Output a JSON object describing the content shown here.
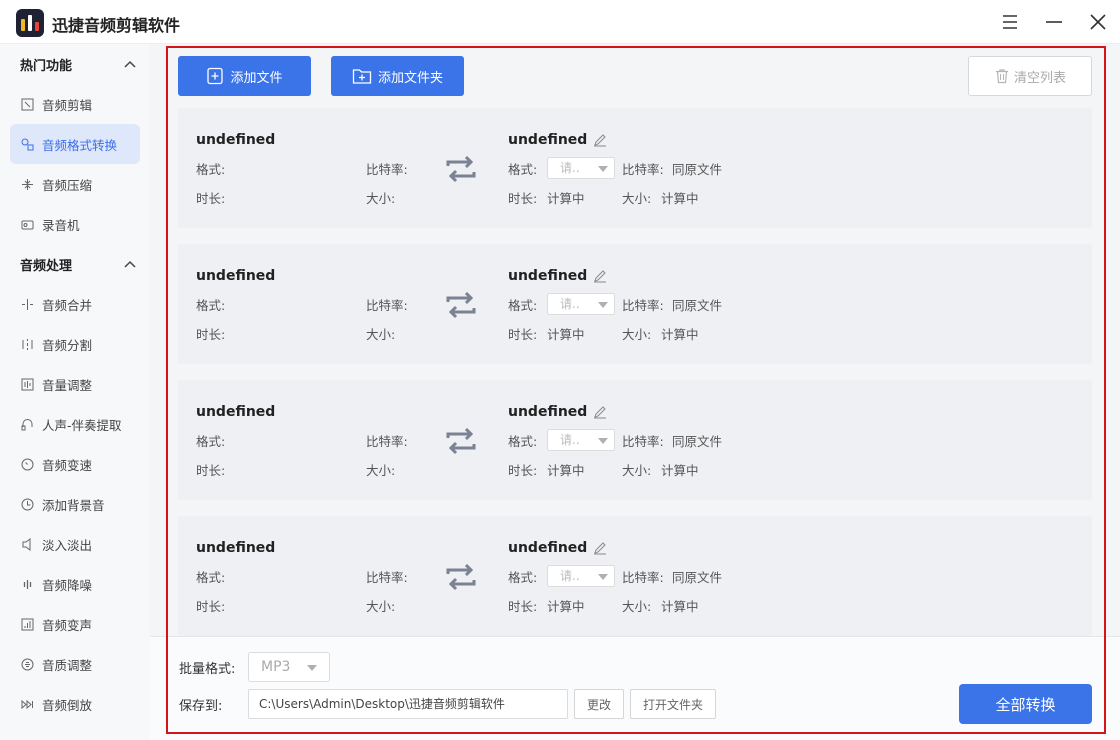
{
  "app": {
    "title": "迅捷音频剪辑软件"
  },
  "sidebar": {
    "sections": [
      {
        "title": "热门功能",
        "items": [
          {
            "label": "音频剪辑",
            "icon": "cut-icon",
            "active": false
          },
          {
            "label": "音频格式转换",
            "icon": "convert-icon",
            "active": true
          },
          {
            "label": "音频压缩",
            "icon": "compress-icon",
            "active": false
          },
          {
            "label": "录音机",
            "icon": "recorder-icon",
            "active": false
          }
        ]
      },
      {
        "title": "音频处理",
        "items": [
          {
            "label": "音频合并",
            "icon": "merge-icon"
          },
          {
            "label": "音频分割",
            "icon": "split-icon"
          },
          {
            "label": "音量调整",
            "icon": "volume-icon"
          },
          {
            "label": "人声-伴奏提取",
            "icon": "headphone-icon"
          },
          {
            "label": "音频变速",
            "icon": "speed-icon"
          },
          {
            "label": "添加背景音",
            "icon": "bgm-icon"
          },
          {
            "label": "淡入淡出",
            "icon": "fade-icon"
          },
          {
            "label": "音频降噪",
            "icon": "denoise-icon"
          },
          {
            "label": "音频变声",
            "icon": "voice-icon"
          },
          {
            "label": "音质调整",
            "icon": "quality-icon"
          },
          {
            "label": "音频倒放",
            "icon": "reverse-icon"
          }
        ]
      }
    ]
  },
  "toolbar": {
    "add_file": "添加文件",
    "add_folder": "添加文件夹",
    "clear_list": "清空列表"
  },
  "files": [
    {
      "name": "undefined",
      "format_label": "格式:",
      "bitrate_label": "比特率:",
      "duration_label": "时长:",
      "size_label": "大小:",
      "out_name": "undefined",
      "out_format_label": "格式:",
      "out_format_placeholder": "请..",
      "out_bitrate_label": "比特率:",
      "out_bitrate": "同原文件",
      "out_duration_label": "时长:",
      "out_duration": "计算中",
      "out_size_label": "大小:",
      "out_size": "计算中"
    },
    {
      "name": "undefined",
      "format_label": "格式:",
      "bitrate_label": "比特率:",
      "duration_label": "时长:",
      "size_label": "大小:",
      "out_name": "undefined",
      "out_format_label": "格式:",
      "out_format_placeholder": "请..",
      "out_bitrate_label": "比特率:",
      "out_bitrate": "同原文件",
      "out_duration_label": "时长:",
      "out_duration": "计算中",
      "out_size_label": "大小:",
      "out_size": "计算中"
    },
    {
      "name": "undefined",
      "format_label": "格式:",
      "bitrate_label": "比特率:",
      "duration_label": "时长:",
      "size_label": "大小:",
      "out_name": "undefined",
      "out_format_label": "格式:",
      "out_format_placeholder": "请..",
      "out_bitrate_label": "比特率:",
      "out_bitrate": "同原文件",
      "out_duration_label": "时长:",
      "out_duration": "计算中",
      "out_size_label": "大小:",
      "out_size": "计算中"
    },
    {
      "name": "undefined",
      "format_label": "格式:",
      "bitrate_label": "比特率:",
      "duration_label": "时长:",
      "size_label": "大小:",
      "out_name": "undefined",
      "out_format_label": "格式:",
      "out_format_placeholder": "请..",
      "out_bitrate_label": "比特率:",
      "out_bitrate": "同原文件",
      "out_duration_label": "时长:",
      "out_duration": "计算中",
      "out_size_label": "大小:",
      "out_size": "计算中"
    }
  ],
  "bottom": {
    "batch_format_label": "批量格式:",
    "batch_format_value": "MP3",
    "save_to_label": "保存到:",
    "save_path": "C:\\Users\\Admin\\Desktop\\迅捷音频剪辑软件",
    "change_button": "更改",
    "open_folder_button": "打开文件夹",
    "convert_all_button": "全部转换"
  },
  "colors": {
    "accent": "#3b73e8",
    "highlight_frame": "#d4141a",
    "sidebar_active_bg": "#dfe7fb"
  }
}
